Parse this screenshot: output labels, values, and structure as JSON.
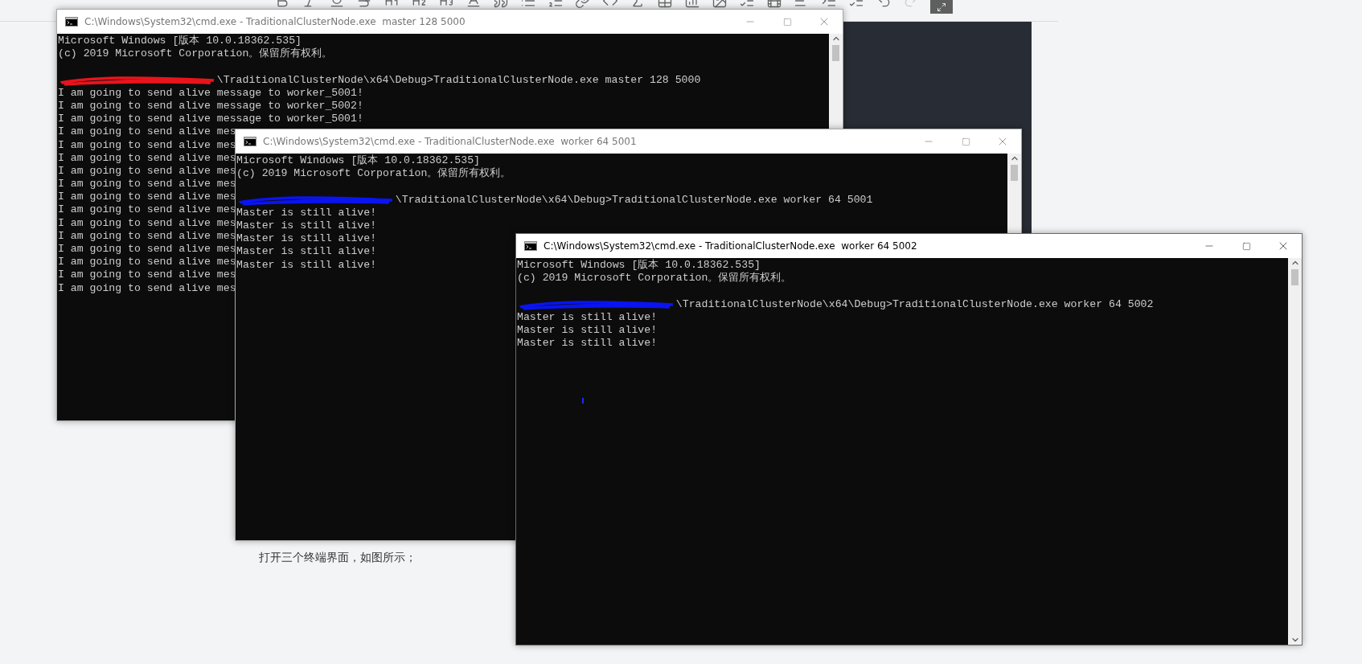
{
  "windows": [
    {
      "title": "C:\\Windows\\System32\\cmd.exe - TraditionalClusterNode.exe  master 128 5000",
      "active": false,
      "banner": [
        "Microsoft Windows [版本 10.0.18362.535]",
        "(c) 2019 Microsoft Corporation。保留所有权利。"
      ],
      "prompt": {
        "redaction": {
          "color": "#e8141c"
        },
        "text": "\\TraditionalClusterNode\\x64\\Debug>TraditionalClusterNode.exe master 128 5000"
      },
      "output": [
        "I am going to send alive message to worker_5001!",
        "I am going to send alive message to worker_5002!",
        "I am going to send alive message to worker_5001!",
        "I am going to send alive mes",
        "I am going to send alive mes",
        "I am going to send alive mes",
        "I am going to send alive mes",
        "I am going to send alive mes",
        "I am going to send alive mes",
        "I am going to send alive mes",
        "I am going to send alive mes",
        "I am going to send alive mes",
        "I am going to send alive mes",
        "I am going to send alive mes",
        "I am going to send alive mes",
        "I am going to send alive mes"
      ]
    },
    {
      "title": "C:\\Windows\\System32\\cmd.exe - TraditionalClusterNode.exe  worker 64 5001",
      "active": false,
      "banner": [
        "Microsoft Windows [版本 10.0.18362.535]",
        "(c) 2019 Microsoft Corporation。保留所有权利。"
      ],
      "prompt": {
        "redaction": {
          "color": "#0a14f0"
        },
        "text": "\\TraditionalClusterNode\\x64\\Debug>TraditionalClusterNode.exe worker 64 5001"
      },
      "output": [
        "Master is still alive!",
        "Master is still alive!",
        "Master is still alive!",
        "Master is still alive!",
        "Master is still alive!"
      ]
    },
    {
      "title": "C:\\Windows\\System32\\cmd.exe - TraditionalClusterNode.exe  worker 64 5002",
      "active": true,
      "banner": [
        "Microsoft Windows [版本 10.0.18362.535]",
        "(c) 2019 Microsoft Corporation。保留所有权利。"
      ],
      "prompt": {
        "redaction": {
          "color": "#0a14f0"
        },
        "text": "\\TraditionalClusterNode\\x64\\Debug>TraditionalClusterNode.exe worker 64 5002"
      },
      "output": [
        "Master is still alive!",
        "Master is still alive!",
        "Master is still alive!"
      ]
    }
  ],
  "caption": "打开三个终端界面，如图所示；"
}
